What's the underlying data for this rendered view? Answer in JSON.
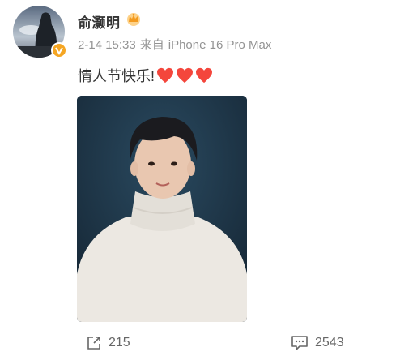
{
  "user": {
    "name": "俞灏明",
    "avatar_icon": "avatar-silhouette",
    "verified_color": "#f5a623"
  },
  "meta": {
    "time": "2-14 15:33",
    "source_prefix": "来自",
    "device": "iPhone 16 Pro Max"
  },
  "post": {
    "text": "情人节快乐!",
    "emoji": [
      "heart",
      "heart",
      "heart"
    ],
    "heart_color": "#f4463c"
  },
  "photo": {
    "alt": "portrait photo"
  },
  "actions": {
    "repost_count": "215",
    "comment_count": "2543"
  }
}
